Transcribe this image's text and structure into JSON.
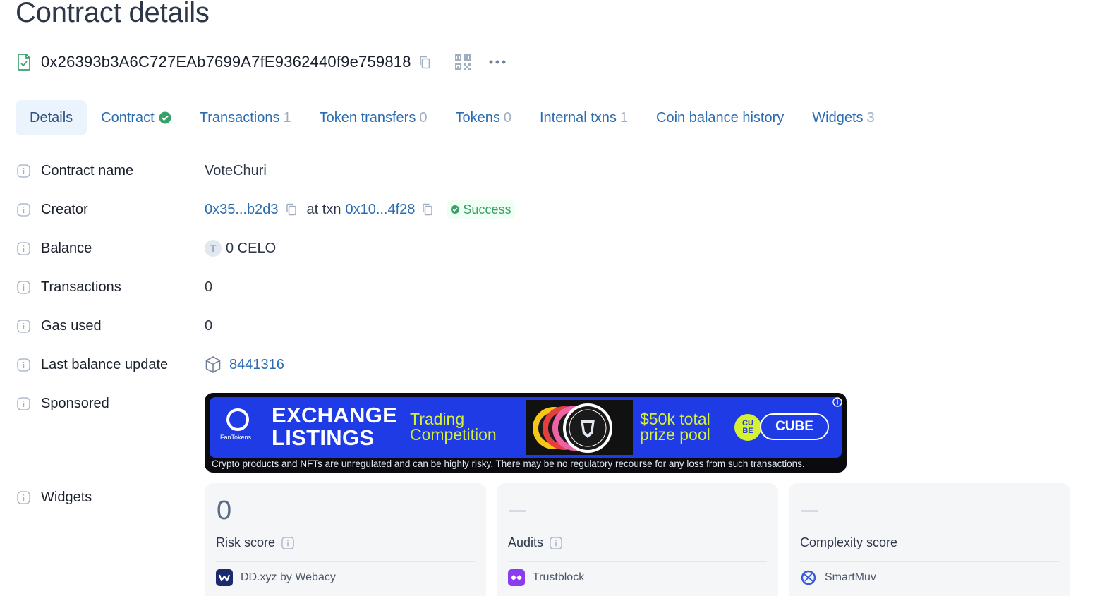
{
  "page": {
    "title": "Contract details"
  },
  "address": {
    "hash": "0x26393b3A6C727EAb7699A7fE9362440f9e759818"
  },
  "tabs": [
    {
      "label": "Details",
      "count": ""
    },
    {
      "label": "Contract",
      "count": ""
    },
    {
      "label": "Transactions",
      "count": "1"
    },
    {
      "label": "Token transfers",
      "count": "0"
    },
    {
      "label": "Tokens",
      "count": "0"
    },
    {
      "label": "Internal txns",
      "count": "1"
    },
    {
      "label": "Coin balance history",
      "count": ""
    },
    {
      "label": "Widgets",
      "count": "3"
    }
  ],
  "details": {
    "contract_name": {
      "label": "Contract name",
      "value": "VoteChuri"
    },
    "creator": {
      "label": "Creator",
      "address": "0x35...b2d3",
      "at_txn": "at txn",
      "txn": "0x10...4f28",
      "status": "Success"
    },
    "balance": {
      "label": "Balance",
      "token_letter": "T",
      "value": "0 CELO"
    },
    "transactions": {
      "label": "Transactions",
      "value": "0"
    },
    "gas_used": {
      "label": "Gas used",
      "value": "0"
    },
    "last_balance_update": {
      "label": "Last balance update",
      "value": "8441316"
    },
    "sponsored": {
      "label": "Sponsored"
    },
    "widgets": {
      "label": "Widgets"
    }
  },
  "banner": {
    "brand": "FanTokens",
    "headline_1": "EXCHANGE",
    "headline_2": "LISTINGS",
    "sub_1": "Trading",
    "sub_2": "Competition",
    "prize_1": "$50k total",
    "prize_2": "prize pool",
    "cube_logo_1": "CU",
    "cube_logo_2": "BE",
    "cube_button": "CUBE",
    "disclaimer": "Crypto products and NFTs are unregulated and can be highly risky. There may be no regulatory recourse for any loss from such transactions."
  },
  "widget_cards": [
    {
      "value": "0",
      "name": "Risk score",
      "provider": "DD.xyz by Webacy"
    },
    {
      "value": "",
      "name": "Audits",
      "provider": "Trustblock"
    },
    {
      "value": "",
      "name": "Complexity score",
      "provider": "SmartMuv"
    }
  ],
  "colors": {
    "link": "#2b6cb0",
    "success": "#38a169",
    "banner_blue": "#1e3be6",
    "banner_accent": "#d6f034"
  }
}
